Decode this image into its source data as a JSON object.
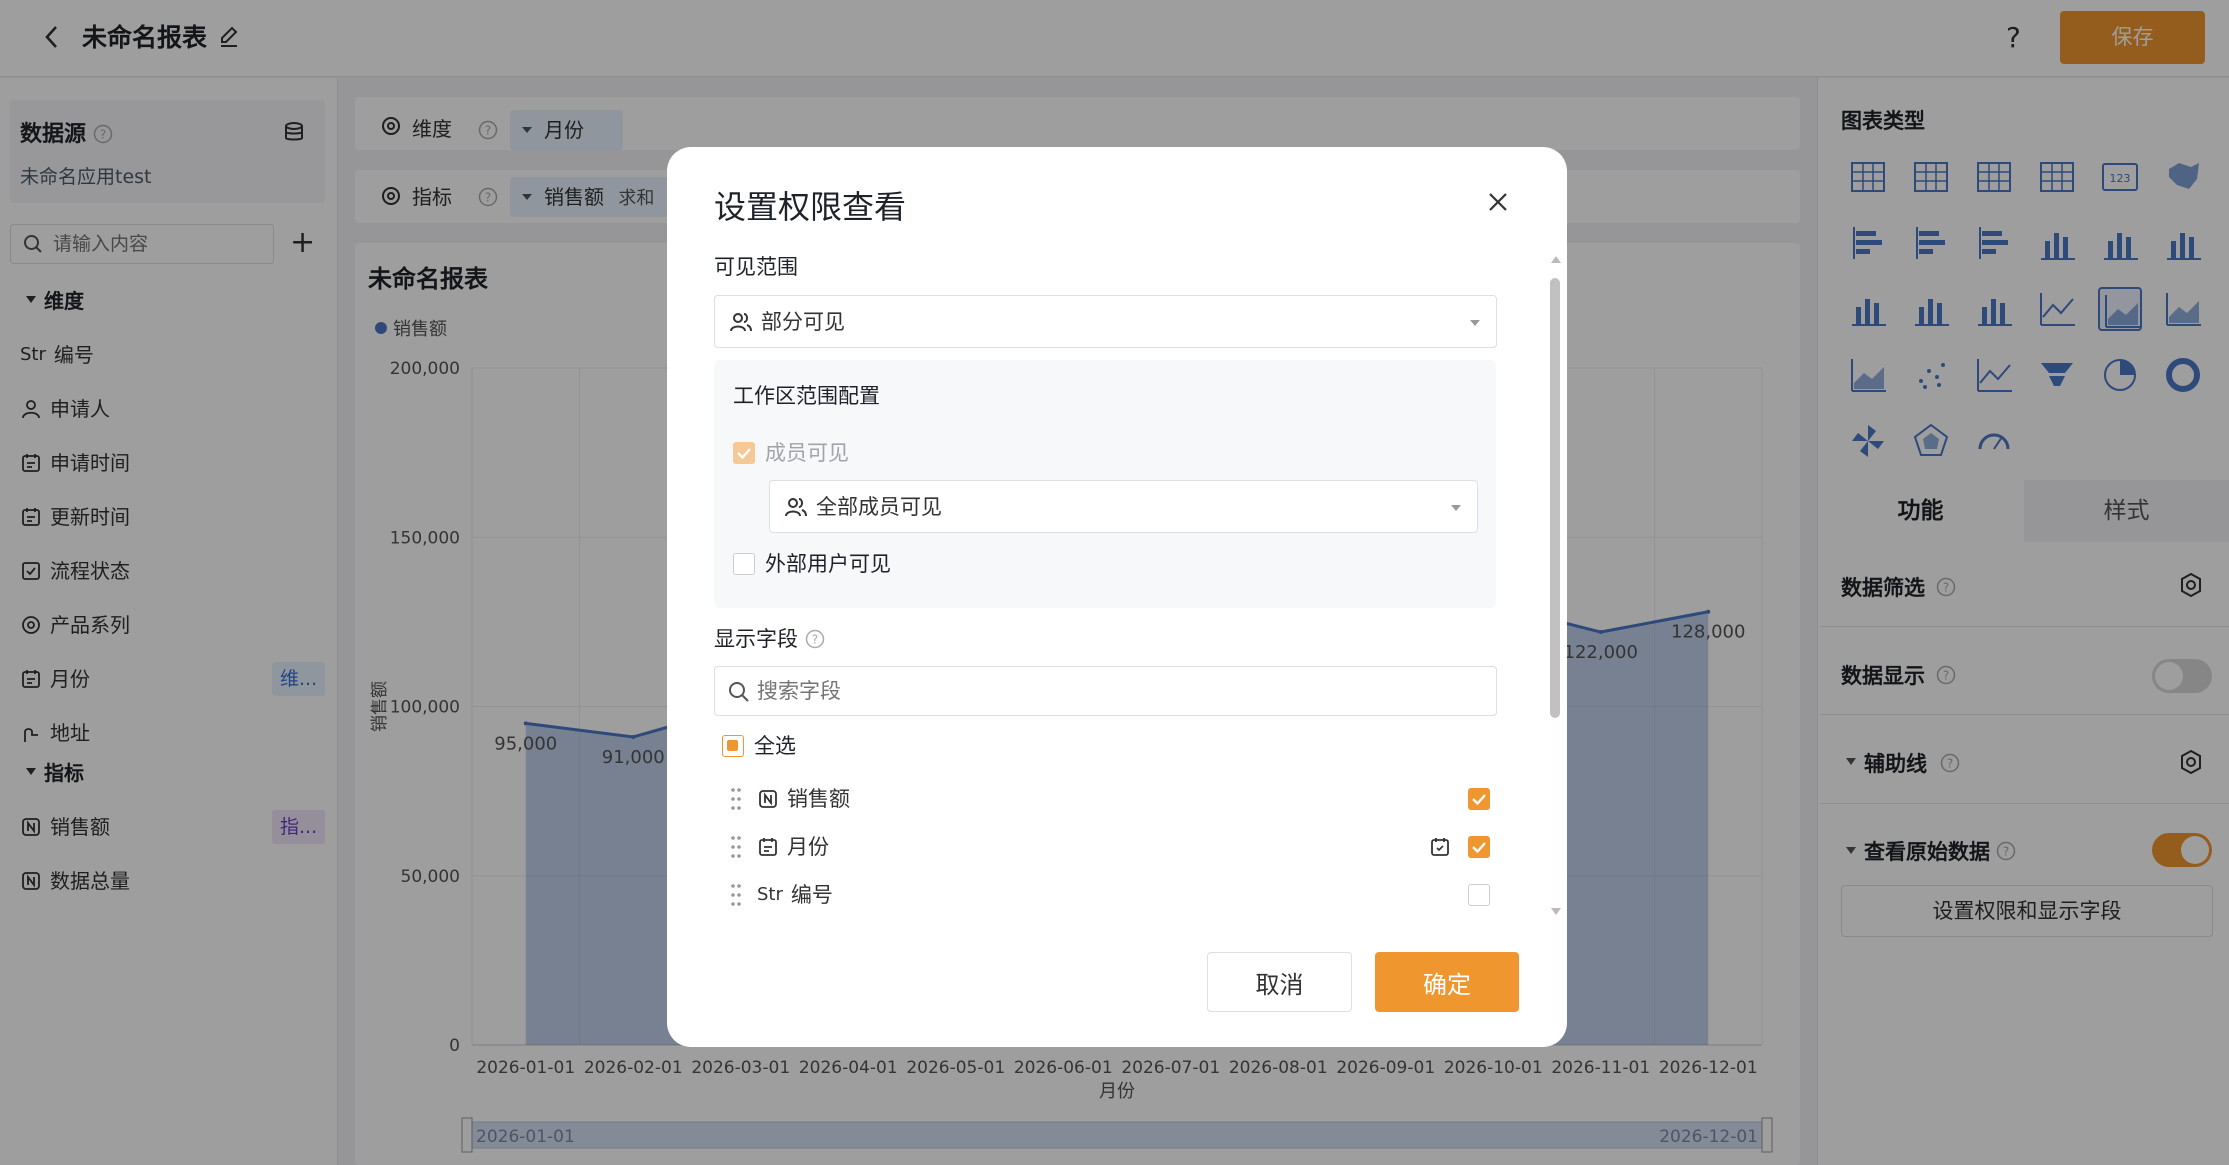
{
  "header": {
    "title": "未命名报表",
    "save_label": "保存",
    "help": "?"
  },
  "left": {
    "datasource_title": "数据源",
    "datasource_name": "未命名应用test",
    "search_placeholder": "请输入内容",
    "groups": [
      {
        "title": "维度",
        "fields": [
          {
            "label": "编号",
            "type": "str",
            "badge": ""
          },
          {
            "label": "申请人",
            "type": "user",
            "badge": ""
          },
          {
            "label": "申请时间",
            "type": "date",
            "badge": ""
          },
          {
            "label": "更新时间",
            "type": "date",
            "badge": ""
          },
          {
            "label": "流程状态",
            "type": "check",
            "badge": ""
          },
          {
            "label": "产品系列",
            "type": "radio",
            "badge": ""
          },
          {
            "label": "月份",
            "type": "date",
            "badge": "维..."
          },
          {
            "label": "地址",
            "type": "geo",
            "badge": ""
          }
        ]
      },
      {
        "title": "指标",
        "fields": [
          {
            "label": "销售额",
            "type": "num",
            "badge": "指..."
          },
          {
            "label": "数据总量",
            "type": "num",
            "badge": ""
          }
        ]
      }
    ],
    "str_prefix": "Str"
  },
  "middle": {
    "dim_label": "维度",
    "dim_chip": "月份",
    "metric_label": "指标",
    "metric_chip": "销售额",
    "metric_chip_agg": "求和",
    "chart_title": "未命名报表"
  },
  "chart_data": {
    "type": "area",
    "title": "未命名报表",
    "xlabel": "月份",
    "ylabel": "销售额",
    "legend": [
      "销售额"
    ],
    "legend_position": "top-left",
    "ylim": [
      0,
      200000
    ],
    "yticks": [
      "0",
      "50,000",
      "100,000",
      "150,000",
      "200,000"
    ],
    "x": [
      "2026-01-01",
      "2026-02-01",
      "2026-03-01",
      "2026-04-01",
      "2026-05-01",
      "2026-06-01",
      "2026-07-01",
      "2026-08-01",
      "2026-09-01",
      "2026-10-01",
      "2026-11-01",
      "2026-12-01"
    ],
    "series": [
      {
        "name": "销售额",
        "values": [
          95000,
          91000,
          100000,
          105000,
          108000,
          110000,
          112000,
          115000,
          118000,
          130000,
          122000,
          128000
        ],
        "labels": [
          "95,000",
          "91,000",
          "",
          "",
          "",
          "",
          "",
          "",
          "",
          "",
          "122,000",
          "128,000"
        ]
      }
    ],
    "slider_start": "2026-01-01",
    "slider_end": "2026-12-01",
    "color": "#4a78c5"
  },
  "right": {
    "chart_types_title": "图表类型",
    "tab_function": "功能",
    "tab_style": "样式",
    "data_filter": "数据筛选",
    "data_display": "数据显示",
    "aux_line": "辅助线",
    "view_raw": "查看原始数据",
    "perm_button": "设置权限和显示字段",
    "icon_123": "123"
  },
  "modal": {
    "title": "设置权限查看",
    "visible_range_label": "可见范围",
    "visible_range_value": "部分可见",
    "workspace_title": "工作区范围配置",
    "member_visible": "成员可见",
    "member_scope": "全部成员可见",
    "external_visible": "外部用户可见",
    "display_fields_label": "显示字段",
    "search_placeholder": "搜索字段",
    "select_all": "全选",
    "fields": [
      {
        "label": "销售额",
        "type": "num",
        "checked": true
      },
      {
        "label": "月份",
        "type": "date",
        "checked": true
      },
      {
        "label": "编号",
        "type": "str",
        "checked": false
      }
    ],
    "str_prefix": "Str",
    "cancel": "取消",
    "ok": "确定"
  },
  "colors": {
    "accent": "#f0962f",
    "chart_line": "#4a78c5",
    "chip_bg": "#e8f3ff"
  }
}
